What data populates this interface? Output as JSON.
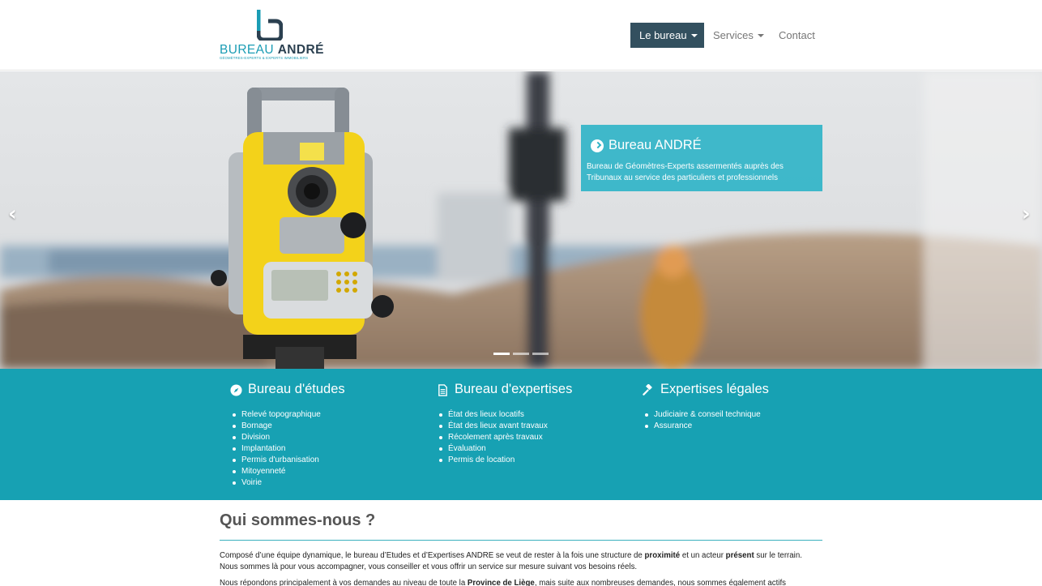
{
  "logo": {
    "name_a": "BUREAU ",
    "name_b": "ANDRÉ",
    "tagline": "GÉOMÈTRES-EXPERTS & EXPERTS IMMOBILIERS"
  },
  "nav": {
    "bureau": "Le bureau",
    "services": "Services",
    "contact": "Contact"
  },
  "hero": {
    "prev": "‹",
    "next": "›",
    "caption_title": "Bureau ANDRÉ",
    "caption_text": "Bureau de Géomètres-Experts assermentés auprès des Tribunaux au service des particuliers et professionnels",
    "slides": 3,
    "active_slide": 1
  },
  "services": {
    "etudes": {
      "title": "Bureau d'études",
      "items": [
        "Relevé topographique",
        "Bornage",
        "Division",
        "Implantation",
        "Permis d'urbanisation",
        "Mitoyenneté",
        "Voirie"
      ]
    },
    "expertises": {
      "title": "Bureau d'expertises",
      "items": [
        "État des lieux locatifs",
        "État des lieux avant travaux",
        "Récolement après travaux",
        "Évaluation",
        "Permis de location"
      ]
    },
    "legales": {
      "title": "Expertises légales",
      "items": [
        "Judiciaire & conseil technique",
        "Assurance"
      ]
    }
  },
  "about": {
    "title": "Qui sommes-nous ?",
    "p1_a": "Composé d’une équipe dynamique, le bureau d’Etudes et d’Expertises ANDRE se veut de rester à la fois une structure de ",
    "p1_b": "proximité",
    "p1_c": " et un acteur ",
    "p1_d": "présent",
    "p1_e": " sur le terrain. Nous sommes là pour vous accompagner, vous conseiller et vous offrir un service sur mesure suivant vos besoins réels.",
    "p2_a": "Nous répondons principalement à vos demandes au niveau de toute la ",
    "p2_b": "Province de Liège",
    "p2_c": ", mais suite aux nombreuses demandes, nous sommes également actifs"
  },
  "colors": {
    "accent": "#17a1b3",
    "nav_active": "#33505f",
    "brand_dark": "#2b4050"
  }
}
